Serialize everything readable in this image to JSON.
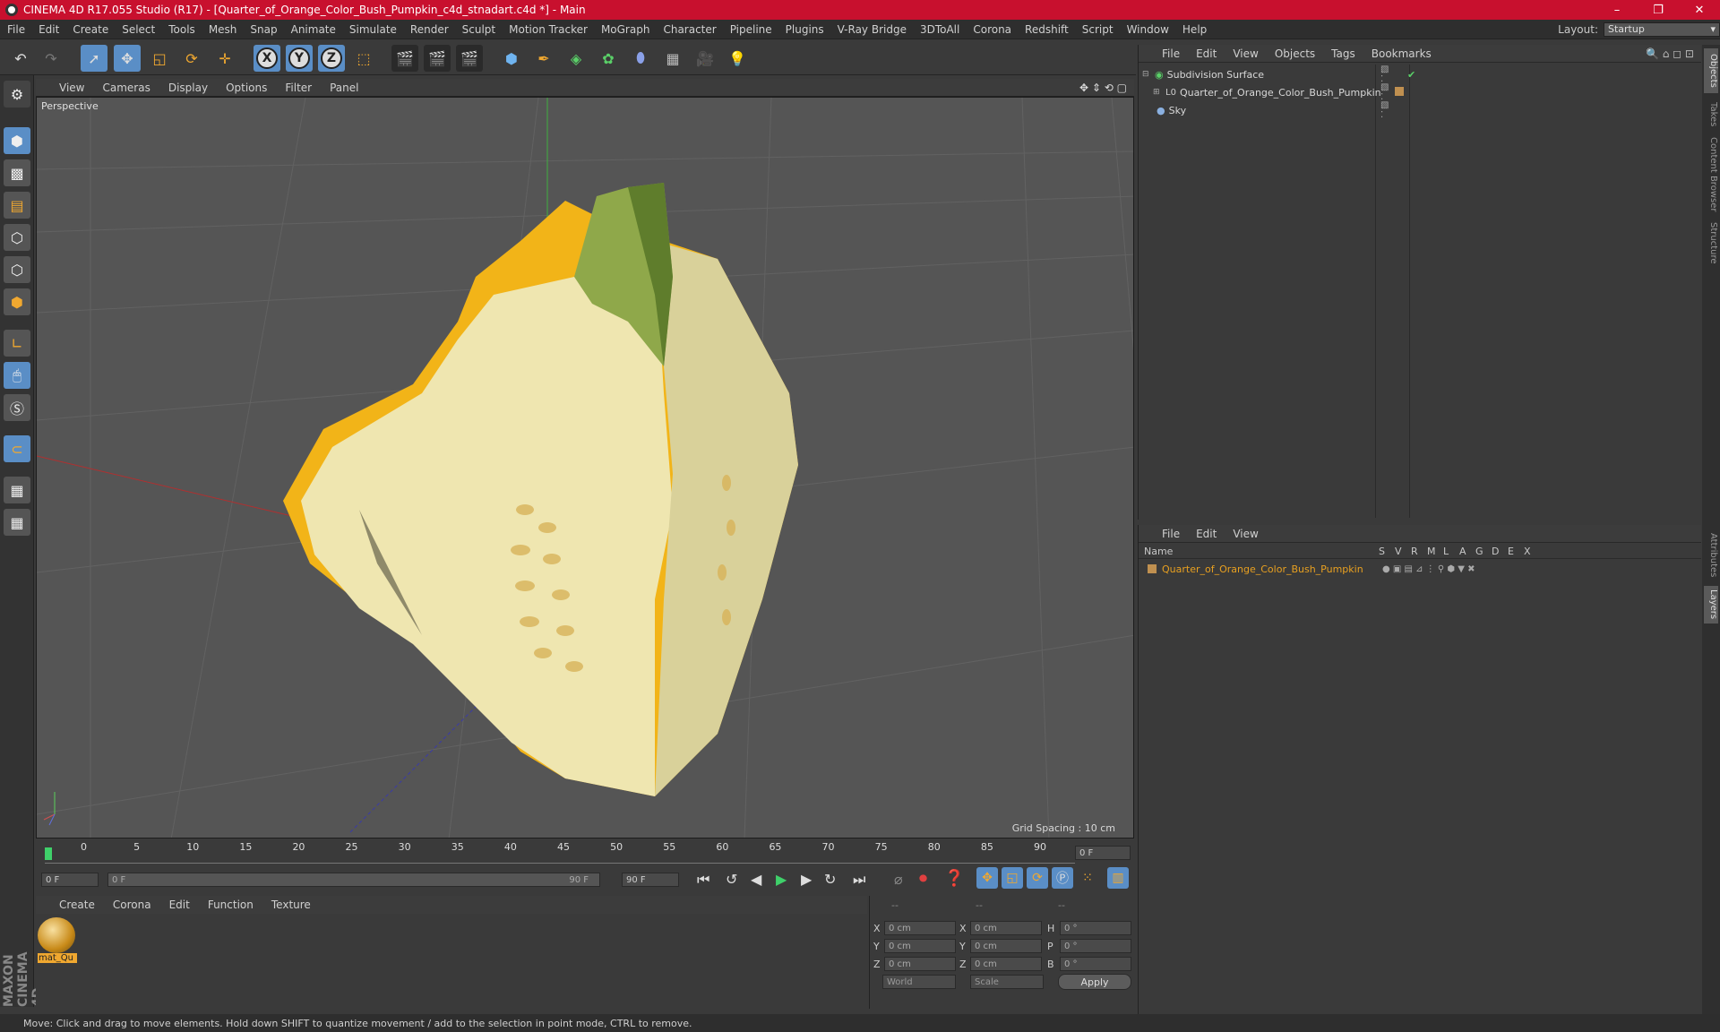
{
  "window": {
    "title": "CINEMA 4D R17.055 Studio (R17) - [Quarter_of_Orange_Color_Bush_Pumpkin_c4d_stnadart.c4d *] - Main",
    "controls": [
      "–",
      "❐",
      "✕"
    ]
  },
  "menu": {
    "items": [
      "File",
      "Edit",
      "Create",
      "Select",
      "Tools",
      "Mesh",
      "Snap",
      "Animate",
      "Simulate",
      "Render",
      "Sculpt",
      "Motion Tracker",
      "MoGraph",
      "Character",
      "Pipeline",
      "Plugins",
      "V-Ray Bridge",
      "3DToAll",
      "Corona",
      "Redshift",
      "Script",
      "Window",
      "Help"
    ],
    "layout_label": "Layout:",
    "layout_value": "Startup"
  },
  "toolbar": {
    "axis_x": "X",
    "axis_y": "Y",
    "axis_z": "Z"
  },
  "viewport": {
    "menu": [
      "View",
      "Cameras",
      "Display",
      "Options",
      "Filter",
      "Panel"
    ],
    "camera_label": "Perspective",
    "grid_spacing": "Grid Spacing : 10 cm"
  },
  "timeline": {
    "ticks": [
      "0",
      "5",
      "10",
      "15",
      "20",
      "25",
      "30",
      "35",
      "40",
      "45",
      "50",
      "55",
      "60",
      "65",
      "70",
      "75",
      "80",
      "85",
      "90"
    ],
    "current_frame": "0 F",
    "start_field": "0 F",
    "range_start": "0 F",
    "range_end": "90 F",
    "end_field": "90 F"
  },
  "materials": {
    "menu": [
      "Create",
      "Corona",
      "Edit",
      "Function",
      "Texture"
    ],
    "items": [
      {
        "label": "mat_Qu"
      }
    ]
  },
  "coordinates": {
    "header": [
      "--",
      "--",
      "--"
    ],
    "rows": [
      {
        "a": "X",
        "av": "0 cm",
        "b": "X",
        "bv": "0 cm",
        "c": "H",
        "cv": "0 °"
      },
      {
        "a": "Y",
        "av": "0 cm",
        "b": "Y",
        "bv": "0 cm",
        "c": "P",
        "cv": "0 °"
      },
      {
        "a": "Z",
        "av": "0 cm",
        "b": "Z",
        "bv": "0 cm",
        "c": "B",
        "cv": "0 °"
      }
    ],
    "mode1": "World",
    "mode2": "Scale",
    "apply": "Apply"
  },
  "object_manager": {
    "menu": [
      "File",
      "Edit",
      "View",
      "Objects",
      "Tags",
      "Bookmarks"
    ],
    "objects": [
      {
        "name": "Subdivision Surface"
      },
      {
        "name": "Quarter_of_Orange_Color_Bush_Pumpkin"
      },
      {
        "name": "Sky"
      }
    ]
  },
  "layer_manager": {
    "menu": [
      "File",
      "Edit",
      "View"
    ],
    "name_header": "Name",
    "flag_headers": [
      "S",
      "V",
      "R",
      "M",
      "L",
      "A",
      "G",
      "D",
      "E",
      "X"
    ],
    "layers": [
      {
        "name": "Quarter_of_Orange_Color_Bush_Pumpkin"
      }
    ]
  },
  "right_tabs": [
    "Objects",
    "Takes",
    "Content Browser",
    "Structure",
    "Attributes",
    "Layers"
  ],
  "status": "Move: Click and drag to move elements. Hold down SHIFT to quantize movement / add to the selection in point mode, CTRL to remove.",
  "colors": {
    "title_bar": "#c8102e",
    "accent_blue": "#5a8ec6",
    "layer_orange": "#e8a020"
  }
}
